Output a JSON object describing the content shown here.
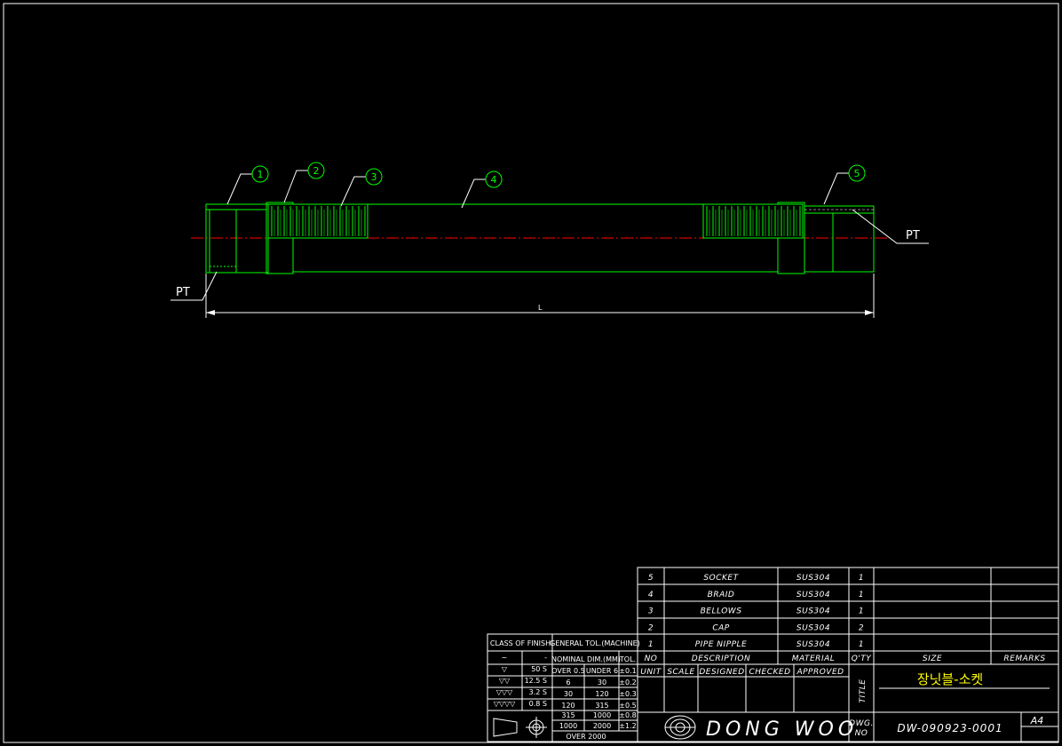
{
  "colors": {
    "background": "#000000",
    "frame": "#ffffff",
    "part": "#00ff00",
    "centerline": "#ff0000",
    "braid_hatch": "#ff00ff",
    "title_text": "#ffff00"
  },
  "drawing": {
    "balloons": [
      "1",
      "2",
      "3",
      "4",
      "5"
    ],
    "thread_left": "PT",
    "thread_right": "PT",
    "length_dim": "L"
  },
  "bom": {
    "rows": [
      {
        "no": "5",
        "description": "SOCKET",
        "material": "SUS304",
        "qty": "1"
      },
      {
        "no": "4",
        "description": "BRAID",
        "material": "SUS304",
        "qty": "1"
      },
      {
        "no": "3",
        "description": "BELLOWS",
        "material": "SUS304",
        "qty": "1"
      },
      {
        "no": "2",
        "description": "CAP",
        "material": "SUS304",
        "qty": "2"
      },
      {
        "no": "1",
        "description": "PIPE NIPPLE",
        "material": "SUS304",
        "qty": "1"
      }
    ],
    "header": {
      "no": "NO",
      "description": "DESCRIPTION",
      "material": "MATERIAL",
      "qty": "Q'TY",
      "size": "SIZE",
      "remarks": "REMARKS"
    }
  },
  "title_block": {
    "unit": "UNIT",
    "scale": "SCALE",
    "designed": "DESIGNED",
    "checked": "CHECKED",
    "approved": "APPROVED",
    "title_label": "TITLE",
    "title": "장닛블-소켓",
    "company": "DONG WOO",
    "dwg_no_label_1": "DWG.",
    "dwg_no_label_2": "NO",
    "dwg_no": "DW-090923-0001",
    "sheet_size": "A4"
  },
  "finish_table": {
    "header": "CLASS OF FINISH",
    "rows": [
      {
        "symbol": "~",
        "value": "-"
      },
      {
        "symbol": "▽",
        "value": "50 S"
      },
      {
        "symbol": "▽▽",
        "value": "12.5 S"
      },
      {
        "symbol": "▽▽▽",
        "value": "3.2 S"
      },
      {
        "symbol": "▽▽▽▽",
        "value": "0.8 S"
      }
    ]
  },
  "tolerance_table": {
    "header": "GENERAL TOL.(MACHINE)",
    "col_dim": "NOMINAL DIM.(MM)",
    "col_tol": "TOL.",
    "rows": [
      {
        "a": "OVER 0.5",
        "b": "UNDER 6",
        "tol": "±0.1"
      },
      {
        "a": "6",
        "b": "30",
        "tol": "±0.2"
      },
      {
        "a": "30",
        "b": "120",
        "tol": "±0.3"
      },
      {
        "a": "120",
        "b": "315",
        "tol": "±0.5"
      },
      {
        "a": "315",
        "b": "1000",
        "tol": "±0.8"
      },
      {
        "a": "1000",
        "b": "2000",
        "tol": "±1.2"
      }
    ],
    "last_row": "OVER 2000"
  }
}
